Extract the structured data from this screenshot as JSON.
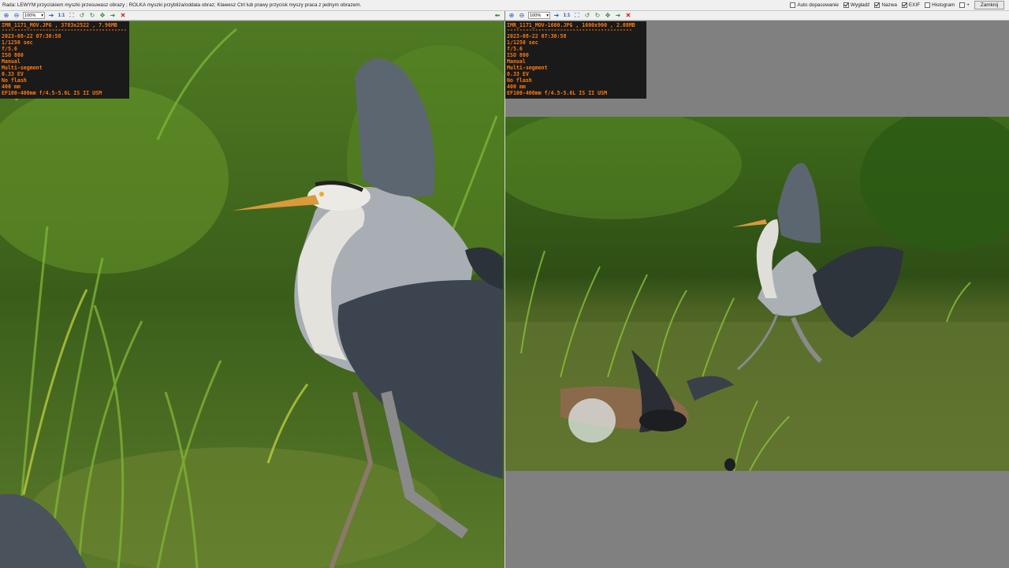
{
  "hint_text": "Rada: LEWYM przyciskiem myszki przesuwasz obrazy ; ROLKA myszki przybliża/oddala obraz; Klawesz Ctrl lub prawy przycisk myszy praca z jednym obrazem.",
  "options": [
    {
      "label": "Auto dopasowanie",
      "checked": false
    },
    {
      "label": "Wygładź",
      "checked": true
    },
    {
      "label": "Nazwa",
      "checked": true
    },
    {
      "label": "EXIF",
      "checked": true
    },
    {
      "label": "Histogram",
      "checked": false
    },
    {
      "label": "+",
      "checked": false
    }
  ],
  "close_label": "Zamknij",
  "left": {
    "zoom": "100%",
    "one_to_one": "1:1",
    "exif": {
      "header": "IMR_1171_MOV.JPG , 3783x2522 , 7.96MB",
      "dashes": "----------------------------------------",
      "datetime": "2023-08-22 07:30:58",
      "shutter": "1/1250 sec",
      "aperture": "f/5.6",
      "iso": "ISO 800",
      "mode": "Manual",
      "metering": "Multi-segment",
      "ev": "0.33 EV",
      "flash": "No flash",
      "focal": "400 mm",
      "lens": "EF100-400mm f/4.5-5.6L IS II USM"
    }
  },
  "right": {
    "zoom": "100%",
    "one_to_one": "1:1",
    "exif": {
      "header": "IMR_1171_MOV-1600.JPG , 1600x900 , 2.08MB",
      "dashes": "----------------------------------------",
      "datetime": "2023-08-22 07:30:58",
      "shutter": "1/1250 sec",
      "aperture": "f/5.6",
      "iso": "ISO 800",
      "mode": "Manual",
      "metering": "Multi-segment",
      "ev": "0.33 EV",
      "flash": "No flash",
      "focal": "400 mm",
      "lens": "EF100-400mm f/4.5-5.6L IS II USM"
    }
  },
  "icons": [
    "zoom-in-icon",
    "zoom-out-icon",
    "prev-arrow-icon",
    "one-to-one-icon",
    "fit-icon",
    "rotate-left-icon",
    "rotate-right-icon",
    "move-icon",
    "next-icon",
    "close-x-icon",
    "back-arrow-icon"
  ]
}
